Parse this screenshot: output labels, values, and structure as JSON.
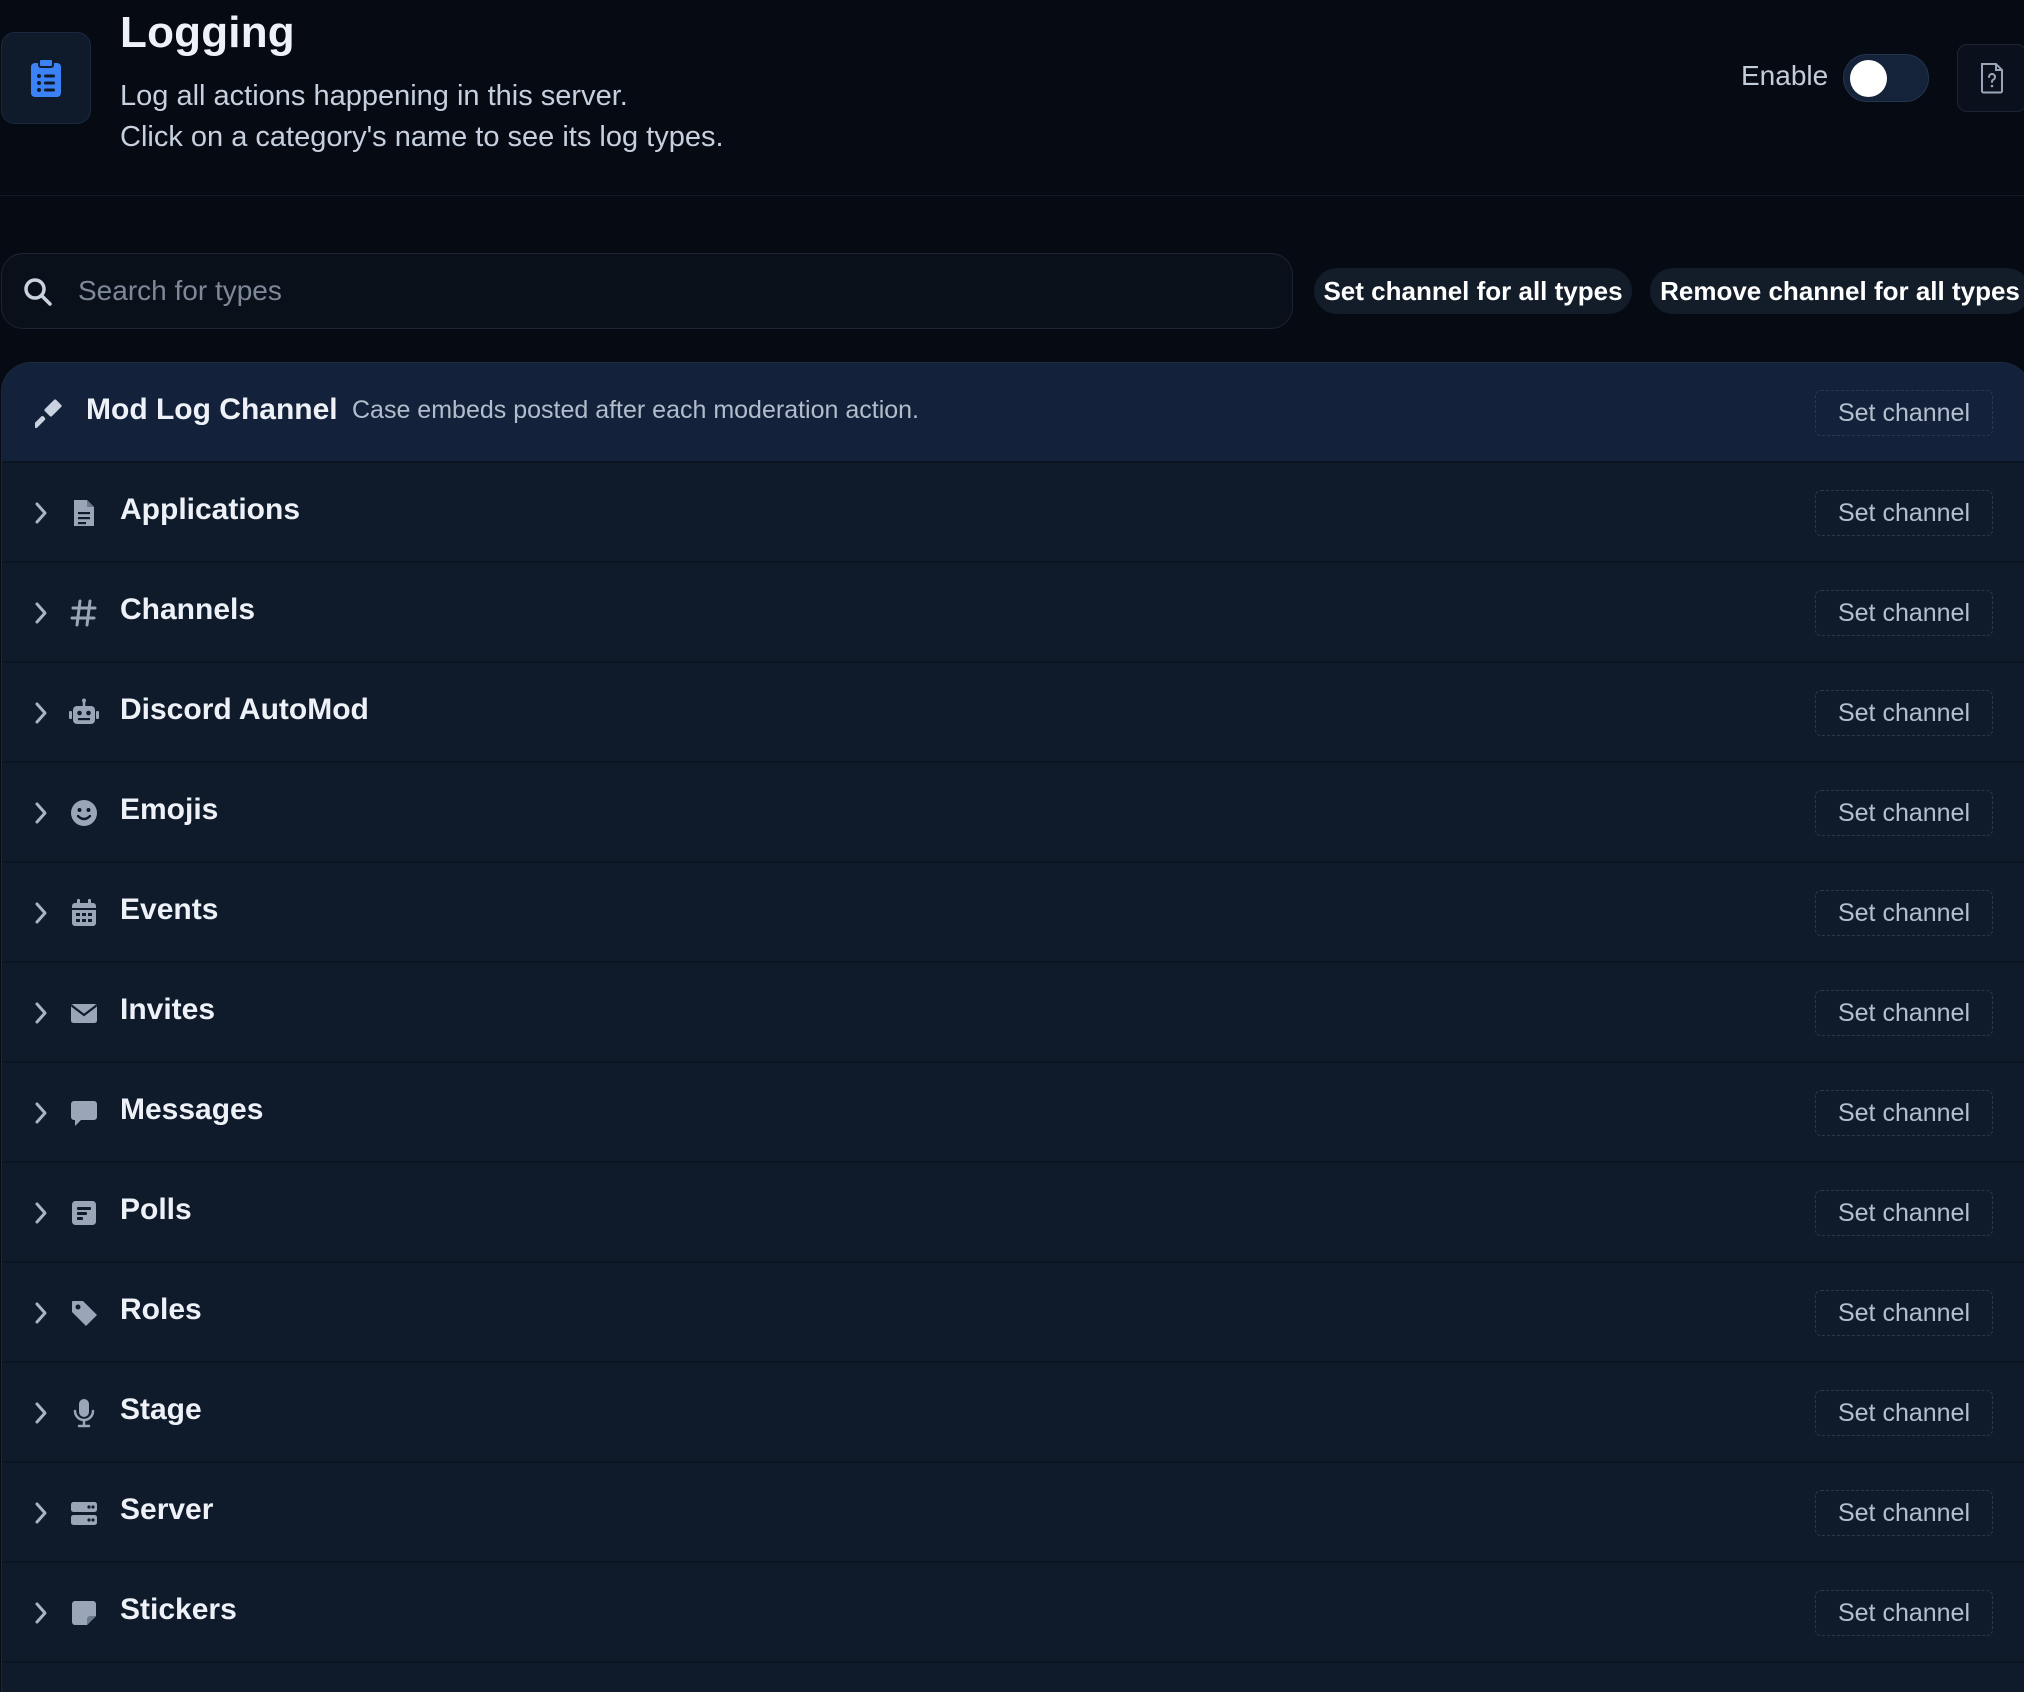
{
  "header": {
    "title": "Logging",
    "description_line1": "Log all actions happening in this server.",
    "description_line2": "Click on a category's name to see its log types.",
    "enable_label": "Enable",
    "enabled": false,
    "accent": "#3b82f6"
  },
  "toolbar": {
    "search_placeholder": "Search for types",
    "set_all_label": "Set channel for all types",
    "remove_all_label": "Remove channel for all types"
  },
  "mod_log": {
    "label": "Mod Log Channel",
    "description": "Case embeds posted after each moderation action.",
    "button_label": "Set channel",
    "icon": "gavel-icon"
  },
  "categories": [
    {
      "label": "Applications",
      "icon": "file-icon",
      "button_label": "Set channel"
    },
    {
      "label": "Channels",
      "icon": "hashtag-icon",
      "button_label": "Set channel"
    },
    {
      "label": "Discord AutoMod",
      "icon": "robot-icon",
      "button_label": "Set channel"
    },
    {
      "label": "Emojis",
      "icon": "smile-icon",
      "button_label": "Set channel"
    },
    {
      "label": "Events",
      "icon": "calendar-icon",
      "button_label": "Set channel"
    },
    {
      "label": "Invites",
      "icon": "envelope-icon",
      "button_label": "Set channel"
    },
    {
      "label": "Messages",
      "icon": "message-icon",
      "button_label": "Set channel"
    },
    {
      "label": "Polls",
      "icon": "poll-icon",
      "button_label": "Set channel"
    },
    {
      "label": "Roles",
      "icon": "tag-icon",
      "button_label": "Set channel"
    },
    {
      "label": "Stage",
      "icon": "microphone-icon",
      "button_label": "Set channel"
    },
    {
      "label": "Server",
      "icon": "server-icon",
      "button_label": "Set channel"
    },
    {
      "label": "Stickers",
      "icon": "sticker-icon",
      "button_label": "Set channel"
    }
  ]
}
